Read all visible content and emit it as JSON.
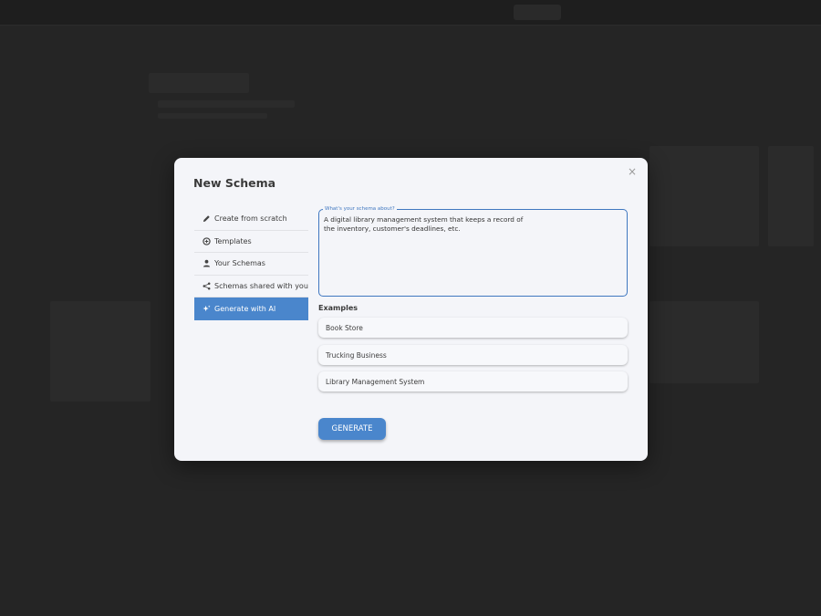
{
  "modal": {
    "title": "New Schema",
    "close_label": "×"
  },
  "nav": {
    "items": [
      {
        "label": "Create from scratch",
        "icon": "pencil-icon"
      },
      {
        "label": "Templates",
        "icon": "templates-icon"
      },
      {
        "label": "Your Schemas",
        "icon": "person-icon"
      },
      {
        "label": "Schemas shared with you",
        "icon": "share-icon"
      },
      {
        "label": "Generate with AI",
        "icon": "sparkle-icon",
        "active": true
      }
    ]
  },
  "form": {
    "field_label": "What's your schema about?",
    "value": "A digital library management system that keeps a record of\nthe inventory, customer's deadlines, etc."
  },
  "examples": {
    "title": "Examples",
    "items": [
      "Book Store",
      "Trucking Business",
      "Library Management System"
    ]
  },
  "generate_label": "GENERATE",
  "colors": {
    "accent": "#4a86cc",
    "backdrop": "#252525",
    "modal_bg": "#f4f5f9"
  }
}
